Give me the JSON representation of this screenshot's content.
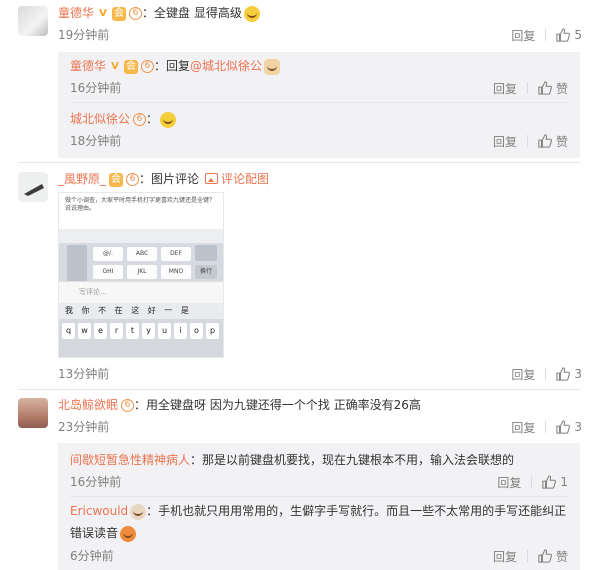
{
  "comments": [
    {
      "user": "童德华",
      "text": "：全键盘  显得高级",
      "time": "19分钟前",
      "reply_label": "回复",
      "like_count": "5",
      "replies": [
        {
          "user": "童德华",
          "prefix": "：回复",
          "mention": "@城北似徐公",
          "time": "16分钟前",
          "reply_label": "回复",
          "like_label": "赞"
        },
        {
          "user": "城北似徐公",
          "prefix": "：",
          "time": "18分钟前",
          "reply_label": "回复",
          "like_label": "赞"
        }
      ]
    },
    {
      "user": "_風野原_",
      "text": "：图片评论",
      "link": "评论配图",
      "time": "13分钟前",
      "reply_label": "回复",
      "like_count": "3",
      "image": {
        "question": "做个小调查，大家平时用手机打字更喜欢九键还是全键？说说理由。",
        "t9_keys": [
          "@/.",
          "ABC",
          "DEF",
          "GHI",
          "JKL",
          "MNO"
        ],
        "send_key": "换行",
        "input_placeholder": "写评论...",
        "candidates": [
          "我",
          "你",
          "不",
          "在",
          "这",
          "好",
          "一",
          "是"
        ],
        "qwerty": [
          "q",
          "w",
          "e",
          "r",
          "t",
          "y",
          "u",
          "i",
          "o",
          "p"
        ]
      }
    },
    {
      "user": "北岛鲸欲眠",
      "text": "：用全键盘呀 因为九键还得一个个找 正确率没有26高",
      "time": "23分钟前",
      "reply_label": "回复",
      "like_count": "3",
      "replies": [
        {
          "user": "间歇短暂急性精神病人",
          "text": "：那是以前键盘机要找，现在九键根本不用，输入法会联想的",
          "time": "16分钟前",
          "reply_label": "回复",
          "like_count": "1"
        },
        {
          "user": "Ericwould",
          "text_line1": "：手机也就只用用常用的，生僻字手写就行。而且一些不太常用的手写还能纠正",
          "text_line2": "错误读音",
          "time": "6分钟前",
          "reply_label": "回复",
          "like_label": "赞"
        }
      ]
    }
  ],
  "badges": {
    "v": "V",
    "vip": "会",
    "level": "6"
  }
}
